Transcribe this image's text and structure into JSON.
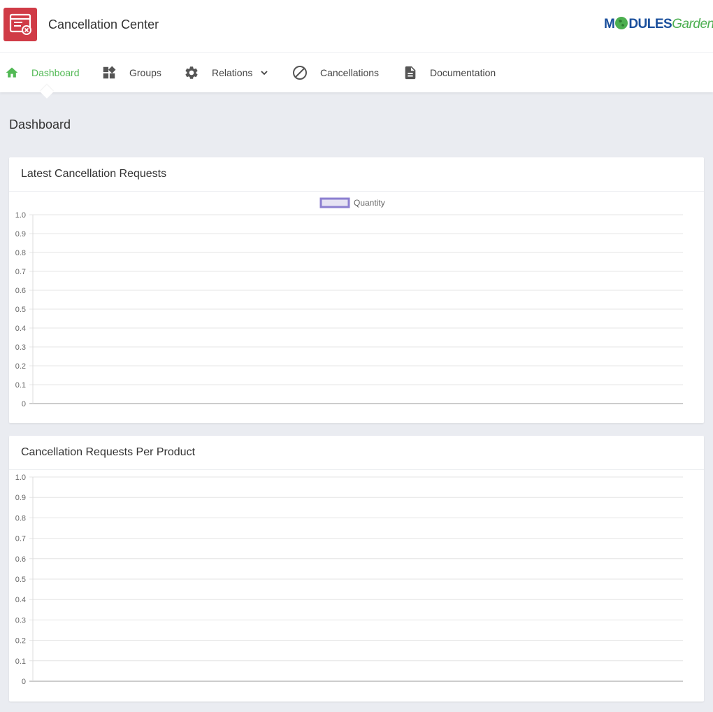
{
  "app": {
    "title": "Cancellation Center"
  },
  "logo": {
    "part1": "M",
    "part2": "DULES",
    "part3": "Garden"
  },
  "nav": {
    "items": [
      {
        "label": "Dashboard",
        "icon": "home-icon",
        "active": true
      },
      {
        "label": "Groups",
        "icon": "widgets-icon"
      },
      {
        "label": "Relations",
        "icon": "gear-icon",
        "dropdown": true
      },
      {
        "label": "Cancellations",
        "icon": "block-icon"
      },
      {
        "label": "Documentation",
        "icon": "document-icon"
      }
    ]
  },
  "page": {
    "title": "Dashboard"
  },
  "panels": {
    "latest": {
      "title": "Latest Cancellation Requests"
    },
    "per_product": {
      "title": "Cancellation Requests Per Product"
    }
  },
  "colors": {
    "accent": "#52b955",
    "brand_red": "#d03b46",
    "legend_border": "#8c7fd0"
  },
  "chart_data": [
    {
      "type": "bar",
      "title": "Latest Cancellation Requests",
      "series": [
        {
          "name": "Quantity",
          "values": []
        }
      ],
      "categories": [],
      "ylim": [
        0,
        1.0
      ],
      "yticks": [
        "1.0",
        "0.9",
        "0.8",
        "0.7",
        "0.6",
        "0.5",
        "0.4",
        "0.3",
        "0.2",
        "0.1",
        "0"
      ],
      "grid": true,
      "legend": "top-center"
    },
    {
      "type": "bar",
      "title": "Cancellation Requests Per Product",
      "series": [],
      "categories": [],
      "ylim": [
        0,
        1.0
      ],
      "yticks": [
        "1.0",
        "0.9",
        "0.8",
        "0.7",
        "0.6",
        "0.5",
        "0.4",
        "0.3",
        "0.2",
        "0.1",
        "0"
      ],
      "grid": true
    }
  ]
}
